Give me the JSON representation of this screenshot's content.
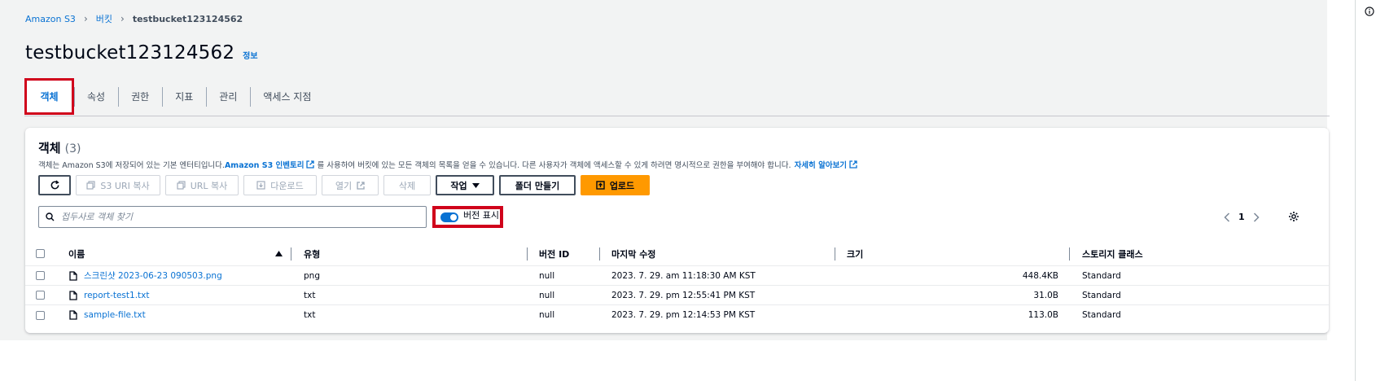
{
  "breadcrumb": [
    "Amazon S3",
    "버킷",
    "testbucket123124562"
  ],
  "page": {
    "title": "testbucket123124562",
    "info": "정보"
  },
  "tabs": [
    "객체",
    "속성",
    "권한",
    "지표",
    "관리",
    "액세스 지점"
  ],
  "objects_panel": {
    "title": "객체",
    "count": "(3)",
    "description_1": "객체는 Amazon S3에 저장되어 있는 기본 엔터티입니다.",
    "inventory_link": "Amazon S3 인벤토리",
    "description_2": "를 사용하여 버킷에 있는 모든 객체의 목록을 얻을 수 있습니다. 다른 사용자가 객체에 액세스할 수 있게 하려면 명시적으로 권한을 부여해야 합니다.",
    "learn_more": "자세히 알아보기"
  },
  "toolbar": {
    "copy_s3_uri": "S3 URI 복사",
    "copy_url": "URL 복사",
    "download": "다운로드",
    "open": "열기",
    "delete": "삭제",
    "actions": "작업",
    "create_folder": "폴더 만들기",
    "upload": "업로드"
  },
  "search": {
    "placeholder": "접두사로 객체 찾기"
  },
  "version_toggle": {
    "label": "버전 표시",
    "on": true
  },
  "pagination": {
    "page": "1"
  },
  "table": {
    "columns": [
      "이름",
      "유형",
      "버전 ID",
      "마지막 수정",
      "크기",
      "스토리지 클래스"
    ],
    "rows": [
      {
        "name": "스크린샷 2023-06-23 090503.png",
        "type": "png",
        "version": "null",
        "modified": "2023. 7. 29. am 11:18:30 AM KST",
        "size": "448.4KB",
        "storage": "Standard"
      },
      {
        "name": "report-test1.txt",
        "type": "txt",
        "version": "null",
        "modified": "2023. 7. 29. pm 12:55:41 PM KST",
        "size": "31.0B",
        "storage": "Standard"
      },
      {
        "name": "sample-file.txt",
        "type": "txt",
        "version": "null",
        "modified": "2023. 7. 29. pm 12:14:53 PM KST",
        "size": "113.0B",
        "storage": "Standard"
      }
    ]
  },
  "colors": {
    "link": "#0972d3",
    "primary": "#ff9900",
    "highlight": "#d0021b"
  }
}
